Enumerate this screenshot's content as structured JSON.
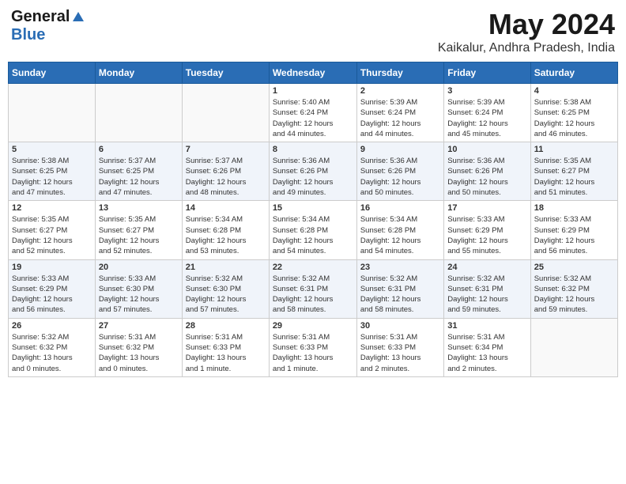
{
  "header": {
    "logo_general": "General",
    "logo_blue": "Blue",
    "month_title": "May 2024",
    "location": "Kaikalur, Andhra Pradesh, India"
  },
  "days_of_week": [
    "Sunday",
    "Monday",
    "Tuesday",
    "Wednesday",
    "Thursday",
    "Friday",
    "Saturday"
  ],
  "weeks": [
    {
      "days": [
        {
          "number": "",
          "info": ""
        },
        {
          "number": "",
          "info": ""
        },
        {
          "number": "",
          "info": ""
        },
        {
          "number": "1",
          "info": "Sunrise: 5:40 AM\nSunset: 6:24 PM\nDaylight: 12 hours\nand 44 minutes."
        },
        {
          "number": "2",
          "info": "Sunrise: 5:39 AM\nSunset: 6:24 PM\nDaylight: 12 hours\nand 44 minutes."
        },
        {
          "number": "3",
          "info": "Sunrise: 5:39 AM\nSunset: 6:24 PM\nDaylight: 12 hours\nand 45 minutes."
        },
        {
          "number": "4",
          "info": "Sunrise: 5:38 AM\nSunset: 6:25 PM\nDaylight: 12 hours\nand 46 minutes."
        }
      ]
    },
    {
      "days": [
        {
          "number": "5",
          "info": "Sunrise: 5:38 AM\nSunset: 6:25 PM\nDaylight: 12 hours\nand 47 minutes."
        },
        {
          "number": "6",
          "info": "Sunrise: 5:37 AM\nSunset: 6:25 PM\nDaylight: 12 hours\nand 47 minutes."
        },
        {
          "number": "7",
          "info": "Sunrise: 5:37 AM\nSunset: 6:26 PM\nDaylight: 12 hours\nand 48 minutes."
        },
        {
          "number": "8",
          "info": "Sunrise: 5:36 AM\nSunset: 6:26 PM\nDaylight: 12 hours\nand 49 minutes."
        },
        {
          "number": "9",
          "info": "Sunrise: 5:36 AM\nSunset: 6:26 PM\nDaylight: 12 hours\nand 50 minutes."
        },
        {
          "number": "10",
          "info": "Sunrise: 5:36 AM\nSunset: 6:26 PM\nDaylight: 12 hours\nand 50 minutes."
        },
        {
          "number": "11",
          "info": "Sunrise: 5:35 AM\nSunset: 6:27 PM\nDaylight: 12 hours\nand 51 minutes."
        }
      ]
    },
    {
      "days": [
        {
          "number": "12",
          "info": "Sunrise: 5:35 AM\nSunset: 6:27 PM\nDaylight: 12 hours\nand 52 minutes."
        },
        {
          "number": "13",
          "info": "Sunrise: 5:35 AM\nSunset: 6:27 PM\nDaylight: 12 hours\nand 52 minutes."
        },
        {
          "number": "14",
          "info": "Sunrise: 5:34 AM\nSunset: 6:28 PM\nDaylight: 12 hours\nand 53 minutes."
        },
        {
          "number": "15",
          "info": "Sunrise: 5:34 AM\nSunset: 6:28 PM\nDaylight: 12 hours\nand 54 minutes."
        },
        {
          "number": "16",
          "info": "Sunrise: 5:34 AM\nSunset: 6:28 PM\nDaylight: 12 hours\nand 54 minutes."
        },
        {
          "number": "17",
          "info": "Sunrise: 5:33 AM\nSunset: 6:29 PM\nDaylight: 12 hours\nand 55 minutes."
        },
        {
          "number": "18",
          "info": "Sunrise: 5:33 AM\nSunset: 6:29 PM\nDaylight: 12 hours\nand 56 minutes."
        }
      ]
    },
    {
      "days": [
        {
          "number": "19",
          "info": "Sunrise: 5:33 AM\nSunset: 6:29 PM\nDaylight: 12 hours\nand 56 minutes."
        },
        {
          "number": "20",
          "info": "Sunrise: 5:33 AM\nSunset: 6:30 PM\nDaylight: 12 hours\nand 57 minutes."
        },
        {
          "number": "21",
          "info": "Sunrise: 5:32 AM\nSunset: 6:30 PM\nDaylight: 12 hours\nand 57 minutes."
        },
        {
          "number": "22",
          "info": "Sunrise: 5:32 AM\nSunset: 6:31 PM\nDaylight: 12 hours\nand 58 minutes."
        },
        {
          "number": "23",
          "info": "Sunrise: 5:32 AM\nSunset: 6:31 PM\nDaylight: 12 hours\nand 58 minutes."
        },
        {
          "number": "24",
          "info": "Sunrise: 5:32 AM\nSunset: 6:31 PM\nDaylight: 12 hours\nand 59 minutes."
        },
        {
          "number": "25",
          "info": "Sunrise: 5:32 AM\nSunset: 6:32 PM\nDaylight: 12 hours\nand 59 minutes."
        }
      ]
    },
    {
      "days": [
        {
          "number": "26",
          "info": "Sunrise: 5:32 AM\nSunset: 6:32 PM\nDaylight: 13 hours\nand 0 minutes."
        },
        {
          "number": "27",
          "info": "Sunrise: 5:31 AM\nSunset: 6:32 PM\nDaylight: 13 hours\nand 0 minutes."
        },
        {
          "number": "28",
          "info": "Sunrise: 5:31 AM\nSunset: 6:33 PM\nDaylight: 13 hours\nand 1 minute."
        },
        {
          "number": "29",
          "info": "Sunrise: 5:31 AM\nSunset: 6:33 PM\nDaylight: 13 hours\nand 1 minute."
        },
        {
          "number": "30",
          "info": "Sunrise: 5:31 AM\nSunset: 6:33 PM\nDaylight: 13 hours\nand 2 minutes."
        },
        {
          "number": "31",
          "info": "Sunrise: 5:31 AM\nSunset: 6:34 PM\nDaylight: 13 hours\nand 2 minutes."
        },
        {
          "number": "",
          "info": ""
        }
      ]
    }
  ]
}
